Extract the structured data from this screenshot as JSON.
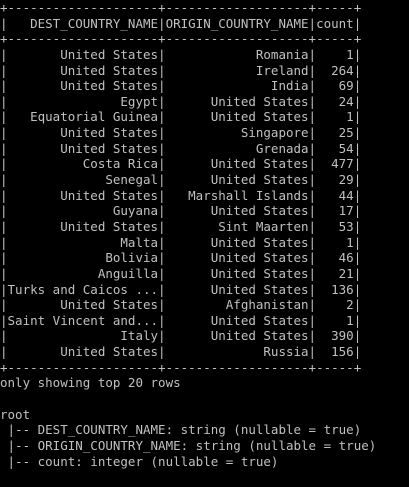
{
  "terminal": {
    "table_sep": "+--------------------+-------------------+-----+",
    "table_header": "|   DEST_COUNTRY_NAME|ORIGIN_COUNTRY_NAME|count|",
    "rows": [
      "|       United States|            Romania|    1|",
      "|       United States|            Ireland|  264|",
      "|       United States|              India|   69|",
      "|               Egypt|      United States|   24|",
      "|   Equatorial Guinea|      United States|    1|",
      "|       United States|          Singapore|   25|",
      "|       United States|            Grenada|   54|",
      "|          Costa Rica|      United States|  477|",
      "|             Senegal|      United States|   29|",
      "|       United States|   Marshall Islands|   44|",
      "|              Guyana|      United States|   17|",
      "|       United States|       Sint Maarten|   53|",
      "|               Malta|      United States|    1|",
      "|             Bolivia|      United States|   46|",
      "|            Anguilla|      United States|   21|",
      "|Turks and Caicos ...|      United States|  136|",
      "|       United States|        Afghanistan|    2|",
      "|Saint Vincent and...|      United States|    1|",
      "|               Italy|      United States|  390|",
      "|       United States|             Russia|  156|"
    ],
    "footer_note": "only showing top 20 rows",
    "blank": "",
    "schema_root": "root",
    "schema_fields": [
      " |-- DEST_COUNTRY_NAME: string (nullable = true)",
      " |-- ORIGIN_COUNTRY_NAME: string (nullable = true)",
      " |-- count: integer (nullable = true)"
    ]
  }
}
